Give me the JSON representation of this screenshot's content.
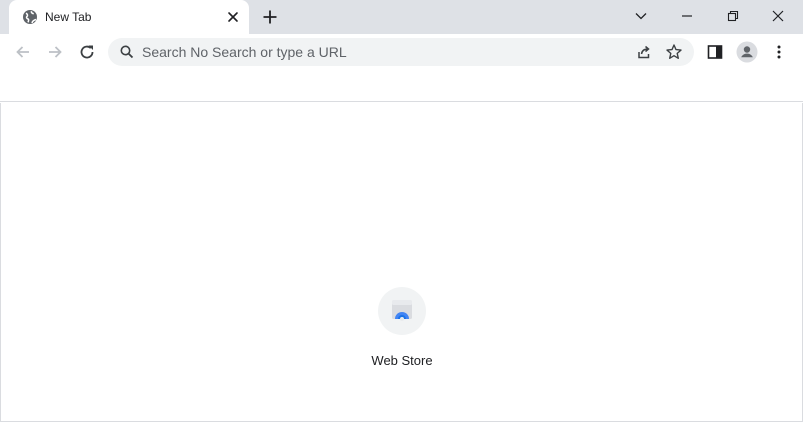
{
  "tab": {
    "title": "New Tab"
  },
  "omnibox": {
    "placeholder": "Search No Search or type a URL"
  },
  "shortcuts": [
    {
      "label": "Web Store"
    }
  ],
  "colors": {
    "tabstrip": "#dee1e6",
    "omnibox_bg": "#f1f3f4",
    "icon": "#5f6368",
    "icon_disabled": "#bdc1c6",
    "webstore_blue": "#4285f4"
  },
  "icons": {
    "favicon": "globe-icon",
    "tab_close": "close-icon",
    "new_tab": "plus-icon",
    "back": "arrow-left-icon",
    "forward": "arrow-right-icon",
    "reload": "reload-icon",
    "share": "share-icon",
    "bookmark": "star-icon",
    "side_panel": "side-panel-icon",
    "profile": "profile-icon",
    "menu": "kebab-menu-icon"
  }
}
